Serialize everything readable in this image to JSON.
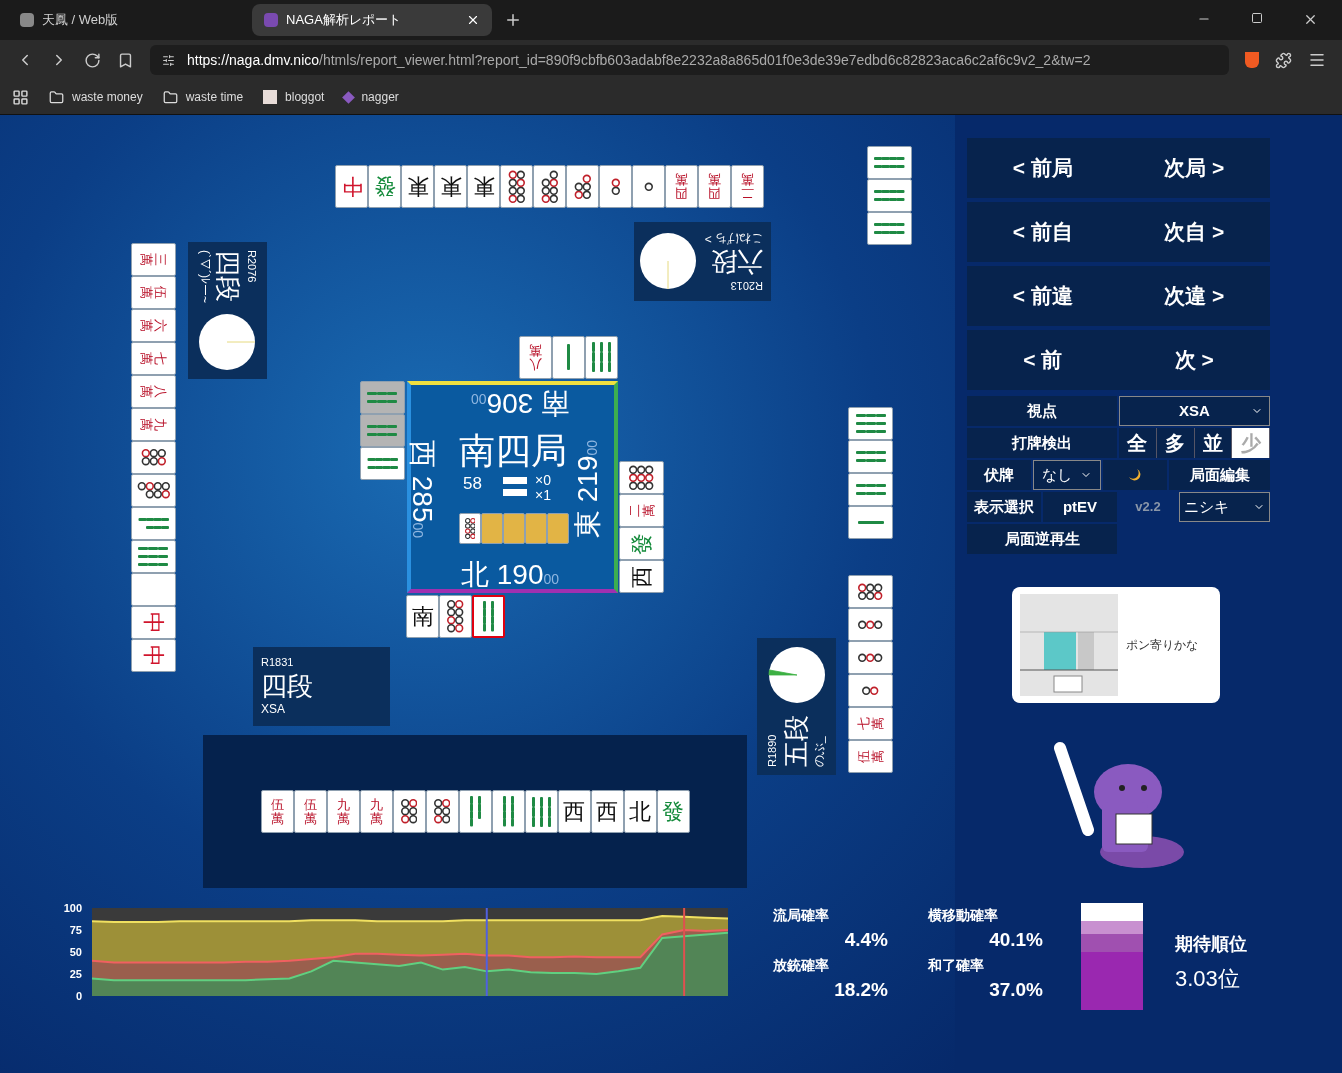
{
  "browser": {
    "tabs": [
      {
        "title": "天鳳 / Web版",
        "selected": false
      },
      {
        "title": "NAGA解析レポート",
        "selected": true
      }
    ],
    "url": {
      "host": "https://naga.dmv.nico",
      "path": "/htmls/report_viewer.html?report_id=890f9cbfb603adabf8e2232a8a865d01f0e3de39e7edbd6c82823aca6c2af6c9v2_2&tw=2"
    },
    "bookmarks": [
      {
        "label": "waste money",
        "kind": "folder"
      },
      {
        "label": "waste time",
        "kind": "folder"
      },
      {
        "label": "bloggot",
        "kind": "site"
      },
      {
        "label": "nagger",
        "kind": "app"
      }
    ]
  },
  "board": {
    "top": {
      "rating": "R2013",
      "rank": "六段",
      "name": "こねげち >",
      "discards": [
        {
          "kind": "honor",
          "text": "中",
          "color": "#d0142c"
        },
        {
          "kind": "honor",
          "text": "發",
          "color": "#138a3a"
        },
        {
          "kind": "honor",
          "text": "東",
          "color": "#111111"
        },
        {
          "kind": "honor",
          "text": "東",
          "color": "#111111"
        },
        {
          "kind": "honor",
          "text": "東",
          "color": "#111111"
        },
        {
          "kind": "p8"
        },
        {
          "kind": "p7"
        },
        {
          "kind": "p5"
        },
        {
          "kind": "p2"
        },
        {
          "kind": "p1"
        },
        {
          "kind": "man",
          "text": "四萬"
        },
        {
          "kind": "man",
          "text": "四萬"
        },
        {
          "kind": "man",
          "text": "二萬"
        }
      ],
      "calls": [
        {
          "kind": "s8"
        },
        {
          "kind": "s8"
        },
        {
          "kind": "s8"
        }
      ],
      "river": [
        {
          "kind": "man",
          "text": "八萬"
        },
        {
          "kind": "s1"
        },
        {
          "kind": "s9"
        }
      ]
    },
    "left": {
      "rating": "R2076",
      "rank": "四段",
      "name": "(`▽´)ﾚー~",
      "hand": [
        {
          "kind": "man",
          "text": "三萬"
        },
        {
          "kind": "man",
          "text": "伍萬"
        },
        {
          "kind": "man",
          "text": "六萬"
        },
        {
          "kind": "man",
          "text": "七萬"
        },
        {
          "kind": "man",
          "text": "八萬"
        },
        {
          "kind": "man",
          "text": "九萬"
        },
        {
          "kind": "p6"
        },
        {
          "kind": "p7"
        },
        {
          "kind": "s7"
        },
        {
          "kind": "s9"
        },
        {
          "kind": "white"
        },
        {
          "kind": "honor",
          "text": "中",
          "color": "#d0142c"
        },
        {
          "kind": "honor",
          "text": "中",
          "color": "#d0142c"
        }
      ],
      "river": [
        {
          "kind": "s6",
          "dimmed": true
        },
        {
          "kind": "s6",
          "dimmed": true
        },
        {
          "kind": "s8",
          "dimmed": false
        }
      ]
    },
    "right": {
      "rating": "R1890",
      "rank": "五段",
      "name": "のぶ_",
      "river": [
        {
          "kind": "p9"
        },
        {
          "kind": "man",
          "text": "二萬"
        },
        {
          "kind": "honor",
          "text": "發",
          "color": "#138a3a"
        },
        {
          "kind": "honor",
          "text": "西",
          "color": "#111111"
        }
      ],
      "discards_upper": [
        {
          "kind": "s9"
        },
        {
          "kind": "s6"
        },
        {
          "kind": "s6"
        },
        {
          "kind": "s1"
        }
      ],
      "discards_lower": [
        {
          "kind": "p6"
        },
        {
          "kind": "p3"
        },
        {
          "kind": "p3"
        },
        {
          "kind": "p2"
        },
        {
          "kind": "man",
          "text": "七萬"
        },
        {
          "kind": "man",
          "text": "伍萬"
        }
      ]
    },
    "bottom": {
      "rating": "R1831",
      "rank": "四段",
      "name": "XSA",
      "river": [
        {
          "kind": "honor",
          "text": "南",
          "color": "#111111",
          "last": false
        },
        {
          "kind": "p8",
          "last": false
        },
        {
          "kind": "s8",
          "last": true
        }
      ],
      "hand": [
        {
          "kind": "man",
          "text": "伍萬"
        },
        {
          "kind": "man",
          "text": "伍萬"
        },
        {
          "kind": "man",
          "text": "九萬"
        },
        {
          "kind": "man",
          "text": "九萬"
        },
        {
          "kind": "p6"
        },
        {
          "kind": "p6"
        },
        {
          "kind": "s7"
        },
        {
          "kind": "s8"
        },
        {
          "kind": "s9"
        },
        {
          "kind": "honor",
          "text": "西",
          "color": "#111111"
        },
        {
          "kind": "honor",
          "text": "西",
          "color": "#111111"
        },
        {
          "kind": "honor",
          "text": "北",
          "color": "#111111"
        },
        {
          "kind": "honor",
          "text": "發",
          "color": "#138a3a"
        }
      ]
    },
    "center": {
      "round": "南四局",
      "remaining": "58",
      "honba": "×0",
      "riichi": "×1",
      "scores": {
        "top": {
          "wind": "南",
          "score": "306",
          "sub": "00"
        },
        "left": {
          "wind": "西",
          "score": "285",
          "sub": "00"
        },
        "right": {
          "wind": "東",
          "score": "219",
          "sub": "00"
        },
        "bottom": {
          "wind": "北",
          "score": "190",
          "sub": "00"
        }
      },
      "dora": [
        {
          "kind": "p8"
        },
        {
          "kind": "back"
        },
        {
          "kind": "back"
        },
        {
          "kind": "back"
        },
        {
          "kind": "back"
        }
      ]
    }
  },
  "controls": {
    "nav": [
      {
        "prev": "< 前局",
        "next": "次局 >"
      },
      {
        "prev": "< 前自",
        "next": "次自 >"
      },
      {
        "prev": "< 前違",
        "next": "次違 >"
      },
      {
        "prev": "< 前",
        "next": "次 >"
      }
    ],
    "viewpoint": {
      "label": "視点",
      "value": "XSA"
    },
    "detect": {
      "label": "打牌検出",
      "options": [
        {
          "label": "全",
          "selected": false
        },
        {
          "label": "多",
          "selected": false
        },
        {
          "label": "並",
          "selected": false
        },
        {
          "label": "少",
          "selected": true
        }
      ]
    },
    "hidden": {
      "label": "伏牌",
      "value": "なし"
    },
    "edit": "局面編集",
    "display": {
      "label": "表示選択",
      "value": "ptEV"
    },
    "version": "v2.2",
    "model": "ニシキ",
    "reverse": "局面逆再生"
  },
  "advice": {
    "text": "ポン寄りかな"
  },
  "chart": {
    "chart_data": {
      "type": "area",
      "ylim": [
        0,
        100
      ],
      "yticks": [
        0,
        25,
        50,
        75,
        100
      ],
      "series": [
        {
          "color": "#f0e060",
          "values": [
            85,
            84,
            84,
            84,
            85,
            85,
            85,
            85,
            85,
            85,
            86,
            86,
            86,
            85,
            85,
            85,
            85,
            86,
            86,
            86,
            86,
            86,
            86,
            86,
            86,
            86,
            91,
            90,
            89,
            88
          ]
        },
        {
          "color": "#f06060",
          "values": [
            40,
            38,
            38,
            38,
            38,
            38,
            38,
            39,
            39,
            40,
            42,
            44,
            48,
            48,
            47,
            46,
            47,
            48,
            46,
            46,
            44,
            44,
            45,
            44,
            44,
            44,
            70,
            75,
            74,
            75
          ]
        },
        {
          "color": "#60d080",
          "values": [
            20,
            18,
            18,
            18,
            18,
            18,
            18,
            18,
            19,
            20,
            28,
            40,
            38,
            36,
            34,
            38,
            30,
            33,
            28,
            30,
            27,
            26,
            26,
            25,
            28,
            32,
            66,
            68,
            70,
            72
          ]
        }
      ]
    }
  },
  "stats": [
    {
      "label": "流局確率",
      "value": "4.4%"
    },
    {
      "label": "横移動確率",
      "value": "40.1%"
    },
    {
      "label": "放銃確率",
      "value": "18.2%"
    },
    {
      "label": "和了確率",
      "value": "37.0%"
    }
  ],
  "expected_rank": {
    "label": "期待順位",
    "value": "3.03位"
  }
}
